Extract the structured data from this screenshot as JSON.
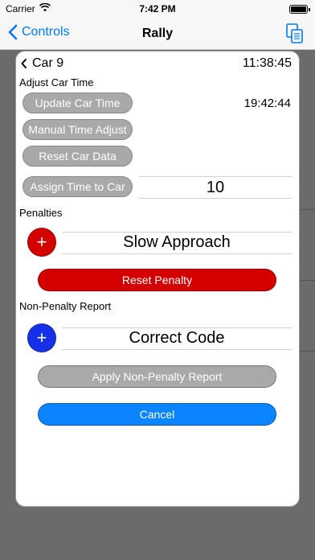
{
  "status_bar": {
    "carrier": "Carrier",
    "time": "7:42 PM"
  },
  "nav": {
    "back_label": "Controls",
    "title": "Rally"
  },
  "modal": {
    "car_label": "Car 9",
    "clock": "11:38:45",
    "adjust_section_label": "Adjust Car Time",
    "buttons": {
      "update_car_time": "Update Car Time",
      "manual_time_adjust": "Manual Time Adjust",
      "reset_car_data": "Reset Car Data",
      "assign_time_to_car": "Assign Time to Car"
    },
    "update_time_display": "19:42:44",
    "time_picker_value": "10",
    "penalties_label": "Penalties",
    "penalty_picker_value": "Slow Approach",
    "reset_penalty_label": "Reset Penalty",
    "non_penalty_label": "Non-Penalty Report",
    "non_penalty_picker_value": "Correct Code",
    "apply_non_penalty_label": "Apply Non-Penalty Report",
    "cancel_label": "Cancel",
    "plus_symbol": "+"
  },
  "colors": {
    "accent": "#007aff",
    "penalty_red": "#d40000",
    "report_blue": "#1530e8",
    "cancel_blue": "#0a84ff",
    "button_gray": "#a9a9a9"
  }
}
